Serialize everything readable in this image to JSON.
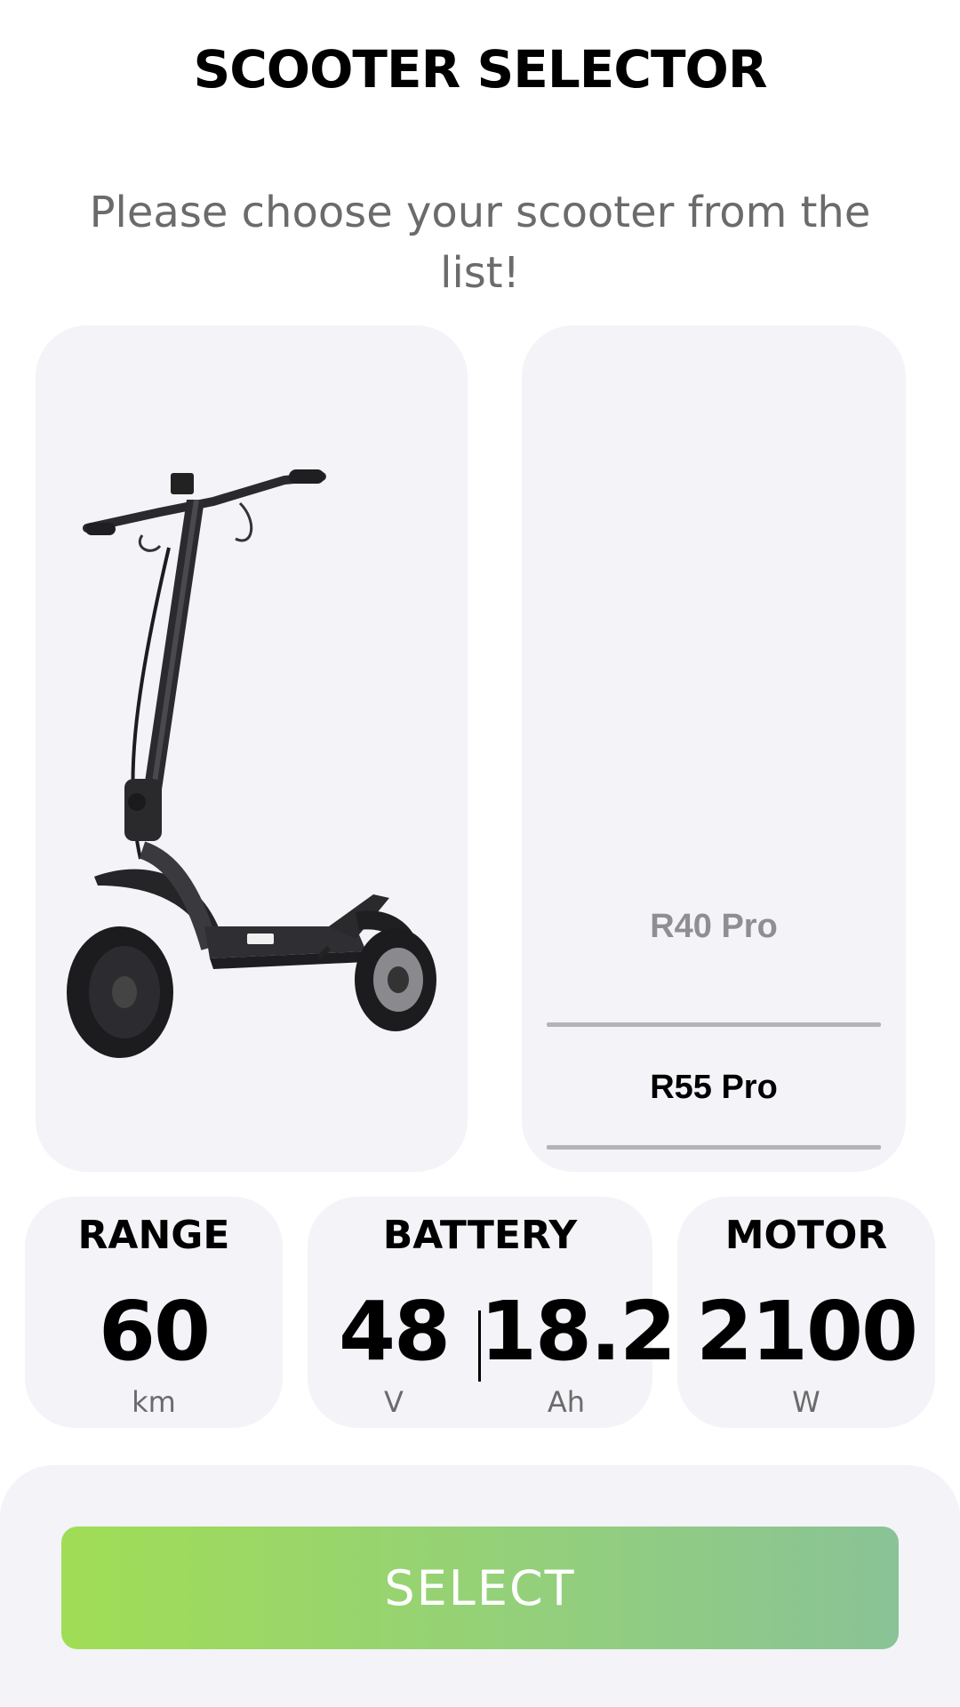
{
  "header": {
    "title": "SCOOTER SELECTOR",
    "subtitle": "Please choose your scooter from the list!"
  },
  "picker": {
    "options": [
      "R40 Pro",
      "R55 Pro"
    ],
    "selected": "R55 Pro"
  },
  "specs": {
    "range": {
      "label": "RANGE",
      "value": "60",
      "unit": "km"
    },
    "battery": {
      "label": "BATTERY",
      "voltage": "48",
      "voltage_unit": "V",
      "capacity": "18.2",
      "capacity_unit": "Ah"
    },
    "motor": {
      "label": "MOTOR",
      "value": "2100",
      "unit": "W"
    }
  },
  "actions": {
    "select_label": "SELECT"
  },
  "colors": {
    "card_bg": "#f3f3f8",
    "button_gradient_start": "#a0dd55",
    "button_gradient_end": "#8ac396",
    "picker_unselected": "#8e8e93",
    "picker_selected": "#000000"
  },
  "image": {
    "icon": "electric-scooter-icon"
  }
}
